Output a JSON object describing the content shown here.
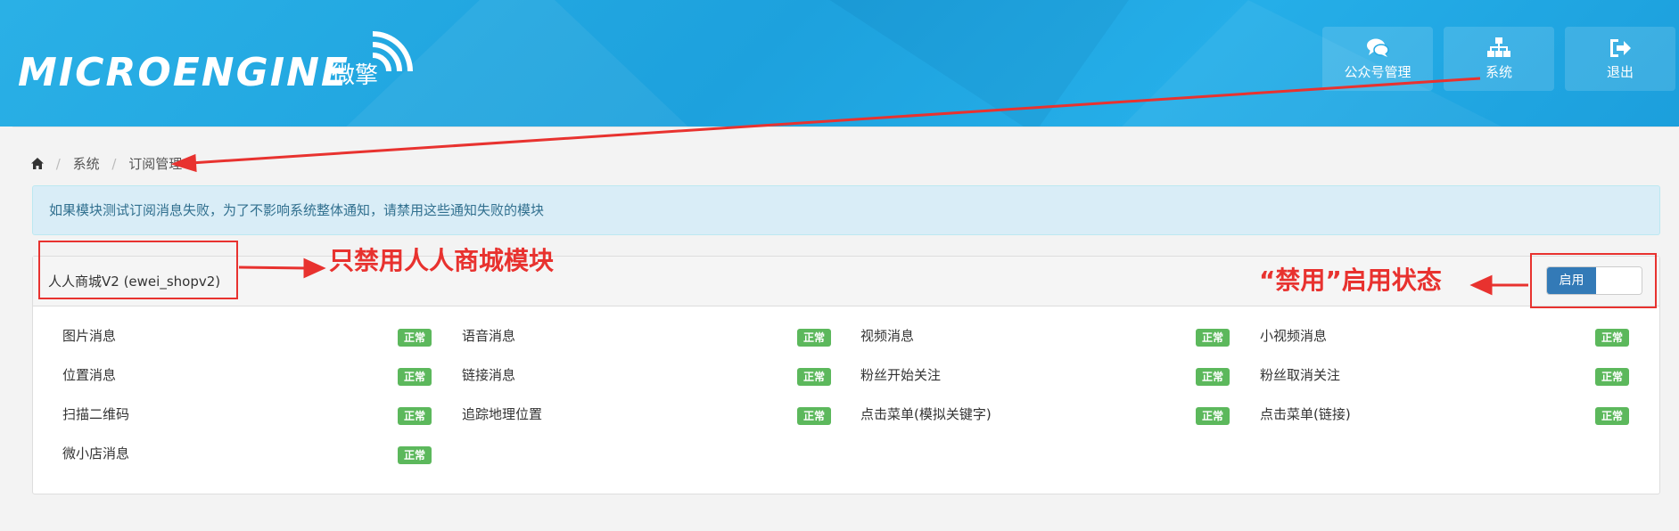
{
  "header": {
    "logo_text": "MICROENGINE",
    "logo_cn": "微擎",
    "buttons": [
      {
        "label": "公众号管理",
        "icon": "comments-icon"
      },
      {
        "label": "系统",
        "icon": "sitemap-icon"
      },
      {
        "label": "退出",
        "icon": "sign-out-icon"
      }
    ]
  },
  "breadcrumb": {
    "items": [
      "系统",
      "订阅管理"
    ]
  },
  "alert": {
    "text": "如果模块测试订阅消息失败，为了不影响系统整体通知，请禁用这些通知失败的模块"
  },
  "panel": {
    "title": "人人商城V2 (ewei_shopv2)",
    "toggle_label": "启用",
    "status_badge": "正常",
    "items": [
      {
        "label": "图片消息",
        "status": "正常"
      },
      {
        "label": "语音消息",
        "status": "正常"
      },
      {
        "label": "视频消息",
        "status": "正常"
      },
      {
        "label": "小视频消息",
        "status": "正常"
      },
      {
        "label": "位置消息",
        "status": "正常"
      },
      {
        "label": "链接消息",
        "status": "正常"
      },
      {
        "label": "粉丝开始关注",
        "status": "正常"
      },
      {
        "label": "粉丝取消关注",
        "status": "正常"
      },
      {
        "label": "扫描二维码",
        "status": "正常"
      },
      {
        "label": "追踪地理位置",
        "status": "正常"
      },
      {
        "label": "点击菜单(模拟关键字)",
        "status": "正常"
      },
      {
        "label": "点击菜单(链接)",
        "status": "正常"
      },
      {
        "label": "微小店消息",
        "status": "正常"
      }
    ]
  },
  "annotations": {
    "module_note": "只禁用人人商城模块",
    "toggle_note": "“禁用”启用状态",
    "color": "#e8322f"
  },
  "colors": {
    "header_blue": "#1da1dd",
    "badge_green": "#5cb85c",
    "toggle_blue": "#337ab7"
  }
}
